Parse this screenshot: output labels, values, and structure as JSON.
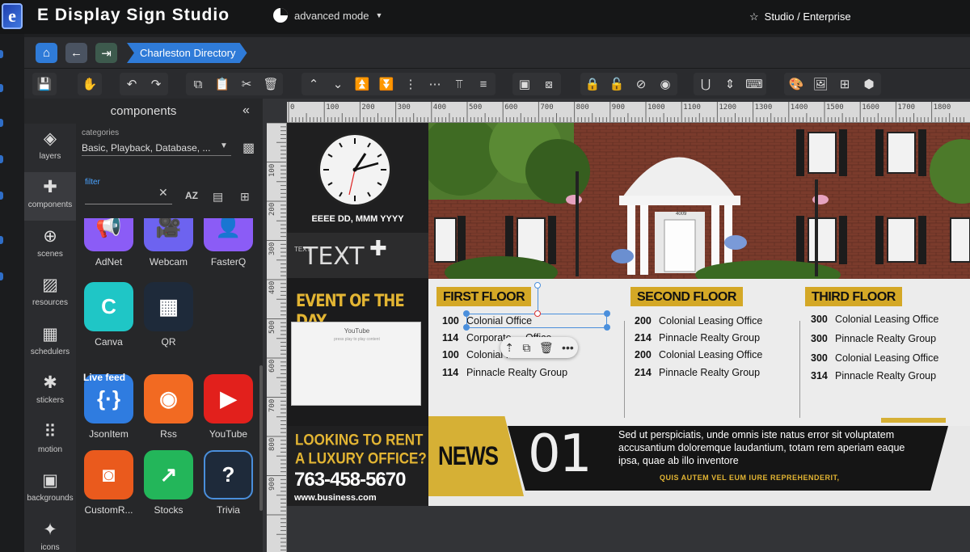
{
  "app": {
    "title": "E Display Sign Studio",
    "logo_letter": "e",
    "mode": "advanced mode",
    "edition": "Studio / Enterprise"
  },
  "nav": {
    "breadcrumb": "Charleston Directory"
  },
  "sidebar": {
    "title": "components",
    "nav_items": [
      "layers",
      "components",
      "scenes",
      "resources",
      "schedulers",
      "stickers",
      "motion",
      "backgrounds",
      "icons"
    ],
    "categories_label": "categories",
    "categories_value": "Basic, Playback, Database, ...",
    "filter_label": "filter",
    "filter_value": "",
    "sort_label": "AZ",
    "components_top": [
      {
        "label": "AdNet",
        "color": "#8b5cf6",
        "glyph": "📢"
      },
      {
        "label": "Webcam",
        "color": "#6d63f0",
        "glyph": "🎥"
      },
      {
        "label": "FasterQ",
        "color": "#8b5cf6",
        "glyph": "👤"
      },
      {
        "label": "Canva",
        "color": "#1fc6c6",
        "glyph": "C"
      },
      {
        "label": "QR",
        "color": "#1e2a3a",
        "glyph": "▦"
      }
    ],
    "live_feed_label": "Live feed",
    "components_live": [
      {
        "label": "JsonItem",
        "color": "#2f7ce0",
        "glyph": "{·}"
      },
      {
        "label": "Rss",
        "color": "#f26a22",
        "glyph": "◉"
      },
      {
        "label": "YouTube",
        "color": "#e2201c",
        "glyph": "▶"
      },
      {
        "label": "CustomR...",
        "color": "#ea5a1d",
        "glyph": "◙"
      },
      {
        "label": "Stocks",
        "color": "#23b65a",
        "glyph": "↗"
      },
      {
        "label": "Trivia",
        "color": "#1e2a3a",
        "glyph": "?"
      }
    ]
  },
  "rulers": {
    "h": [
      "0",
      "100",
      "200",
      "300",
      "400",
      "500",
      "600",
      "700",
      "800",
      "900",
      "1000",
      "1100",
      "1200",
      "1300",
      "1400",
      "1500",
      "1600",
      "1700",
      "1800"
    ],
    "v": [
      "100",
      "200",
      "300",
      "400",
      "500",
      "600",
      "700",
      "800",
      "900"
    ]
  },
  "sign": {
    "clock_date": "EEEE DD, MMM YYYY",
    "text_big": "TEXT",
    "text_small": "TEXT",
    "event_title": "EVENT OF THE DAY",
    "youtube_title": "YouTube",
    "youtube_sub": "press play to play content",
    "rent_line1": "LOOKING TO RENT",
    "rent_line2": "A LUXURY OFFICE?",
    "rent_phone": "763-458-5670",
    "rent_web": "www.business.com",
    "house_number": "4009",
    "floors": [
      {
        "title": "FIRST FLOOR",
        "rows": [
          [
            "100",
            "Colonial Office"
          ],
          [
            "114",
            "Corporate ... Office"
          ],
          [
            "100",
            "Colonial ..."
          ],
          [
            "114",
            "Pinnacle Realty Group"
          ]
        ]
      },
      {
        "title": "SECOND FLOOR",
        "rows": [
          [
            "200",
            "Colonial Leasing Office"
          ],
          [
            "214",
            "Pinnacle Realty Group"
          ],
          [
            "200",
            "Colonial Leasing Office"
          ],
          [
            "214",
            "Pinnacle Realty Group"
          ]
        ]
      },
      {
        "title": "THIRD FLOOR",
        "rows": [
          [
            "300",
            "Colonial Leasing Office"
          ],
          [
            "300",
            "Pinnacle Realty Group"
          ],
          [
            "300",
            "Colonial Leasing Office"
          ],
          [
            "314",
            "Pinnacle Realty Group"
          ]
        ]
      }
    ],
    "news_label": "NEWS",
    "news_number": "01",
    "news_body": "Sed ut perspiciatis, unde omnis iste natus error sit voluptatem accusantium doloremque laudantium, totam rem aperiam eaque ipsa, quae ab illo inventore",
    "news_tag": "QUIS AUTEM VEL EUM IURE REPREHENDERIT,"
  },
  "colors": {
    "accent": "#2f7bd8",
    "gold": "#d4a826",
    "dark": "#151617"
  }
}
